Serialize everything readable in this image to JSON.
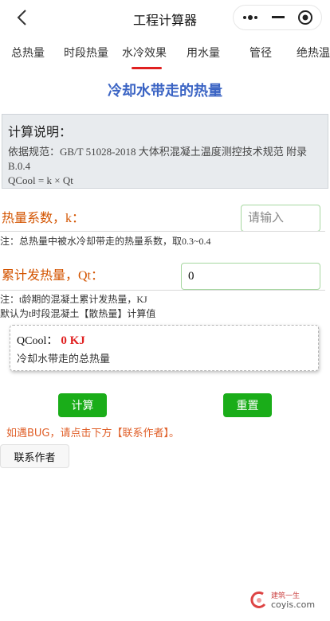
{
  "header": {
    "title": "工程计算器",
    "icons": {
      "back": "chevron-left-icon",
      "more": "more-dots-icon",
      "minimize": "minimize-icon",
      "close": "close-circle-icon"
    }
  },
  "tabs": [
    {
      "label": "总热量",
      "active": false
    },
    {
      "label": "时段热量",
      "active": false
    },
    {
      "label": "水冷效果",
      "active": true
    },
    {
      "label": "用水量",
      "active": false
    },
    {
      "label": "管径",
      "active": false
    },
    {
      "label": "绝热温",
      "active": false
    }
  ],
  "section_title": "冷却水带走的热量",
  "explanation": {
    "title": "计算说明：",
    "basis": "依据规范：GB/T 51028-2018 大体积混凝土温度测控技术规范 附录B.0.4",
    "formula": "QCool = k × Qt"
  },
  "fields": {
    "k": {
      "label": "热量系数，k：",
      "value": "",
      "placeholder": "请输入",
      "note": "注：总热量中被水冷却带走的热量系数，取0.3~0.4"
    },
    "qt": {
      "label": "累计发热量，Qt：",
      "value": "0",
      "placeholder": "",
      "note_line1": "注：t龄期的混凝土累计发热量，KJ",
      "note_line2": "默认为t时段混凝土【散热量】计算值"
    }
  },
  "result": {
    "name": "QCool：",
    "value": "0 KJ",
    "description": "冷却水带走的总热量"
  },
  "buttons": {
    "calculate": "计算",
    "reset": "重置",
    "contact": "联系作者"
  },
  "bug_tip": "如遇BUG，请点击下方【联系作者】。",
  "watermark": {
    "top_text": "建筑一生",
    "bottom_text": "coyis.com"
  },
  "colors": {
    "accent_green": "#1aad19",
    "title_blue": "#3b64c4",
    "label_orange": "#d35400",
    "result_red": "#e02020",
    "tab_indicator": "#e02020"
  }
}
